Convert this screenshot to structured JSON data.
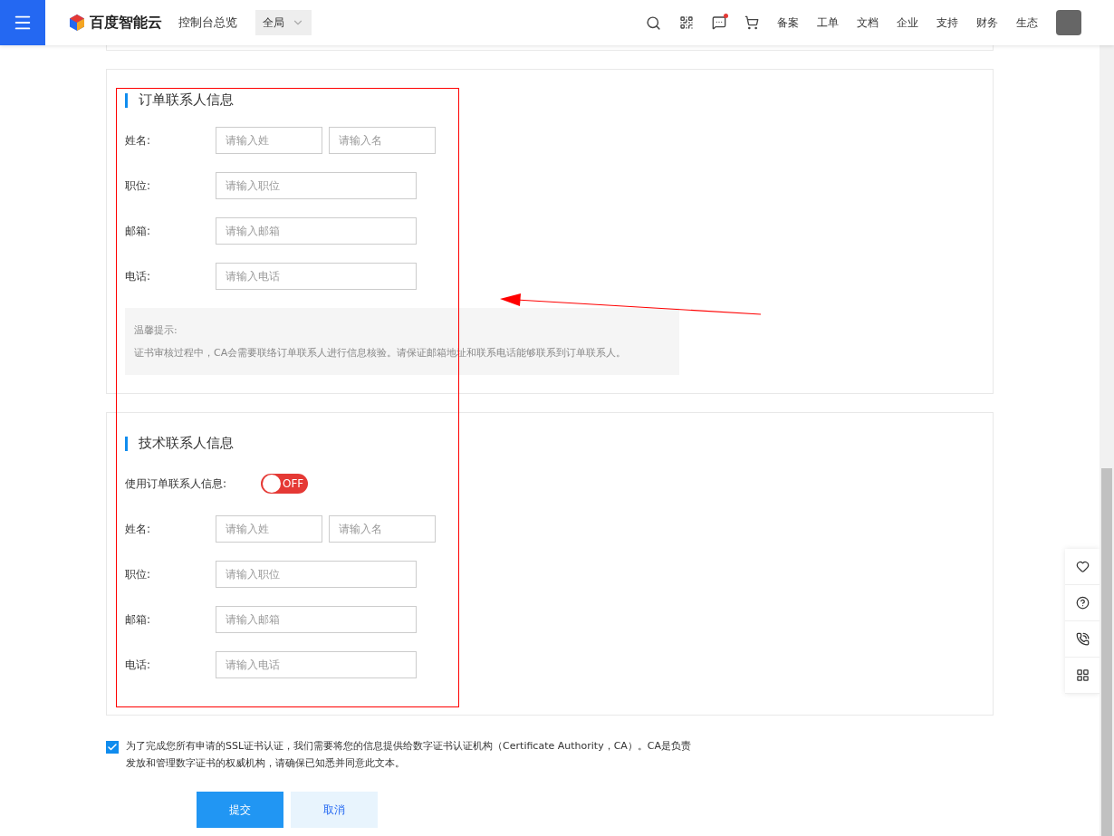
{
  "header": {
    "logo_text": "百度智能云",
    "console_link": "控制台总览",
    "region_select": {
      "value": "全局"
    },
    "message_unread": true,
    "nav_links": [
      "备案",
      "工单",
      "文档",
      "企业",
      "支持",
      "财务",
      "生态"
    ]
  },
  "sections": [
    {
      "title": "订单联系人信息",
      "fields": [
        {
          "label": "姓名:",
          "inputs": [
            {
              "placeholder": "请输入姓"
            },
            {
              "placeholder": "请输入名"
            }
          ]
        },
        {
          "label": "职位:",
          "inputs": [
            {
              "placeholder": "请输入职位"
            }
          ]
        },
        {
          "label": "邮箱:",
          "inputs": [
            {
              "placeholder": "请输入邮箱"
            }
          ]
        },
        {
          "label": "电话:",
          "inputs": [
            {
              "placeholder": "请输入电话"
            }
          ]
        }
      ],
      "tip": {
        "title": "温馨提示:",
        "text": "证书审核过程中，CA会需要联络订单联系人进行信息核验。请保证邮箱地址和联系电话能够联系到订单联系人。"
      }
    },
    {
      "title": "技术联系人信息",
      "toggle": {
        "label": "使用订单联系人信息:",
        "on": false,
        "text": "OFF"
      },
      "fields": [
        {
          "label": "姓名:",
          "inputs": [
            {
              "placeholder": "请输入姓"
            },
            {
              "placeholder": "请输入名"
            }
          ]
        },
        {
          "label": "职位:",
          "inputs": [
            {
              "placeholder": "请输入职位"
            }
          ]
        },
        {
          "label": "邮箱:",
          "inputs": [
            {
              "placeholder": "请输入邮箱"
            }
          ]
        },
        {
          "label": "电话:",
          "inputs": [
            {
              "placeholder": "请输入电话"
            }
          ]
        }
      ]
    }
  ],
  "agreement": {
    "checked": true,
    "text": "为了完成您所有申请的SSL证书认证，我们需要将您的信息提供给数字证书认证机构（Certificate Authority，CA）。CA是负责发放和管理数字证书的权威机构，请确保已知悉并同意此文本。"
  },
  "buttons": [
    {
      "label": "提交",
      "kind": "primary"
    },
    {
      "label": "取消",
      "kind": "secondary"
    }
  ]
}
